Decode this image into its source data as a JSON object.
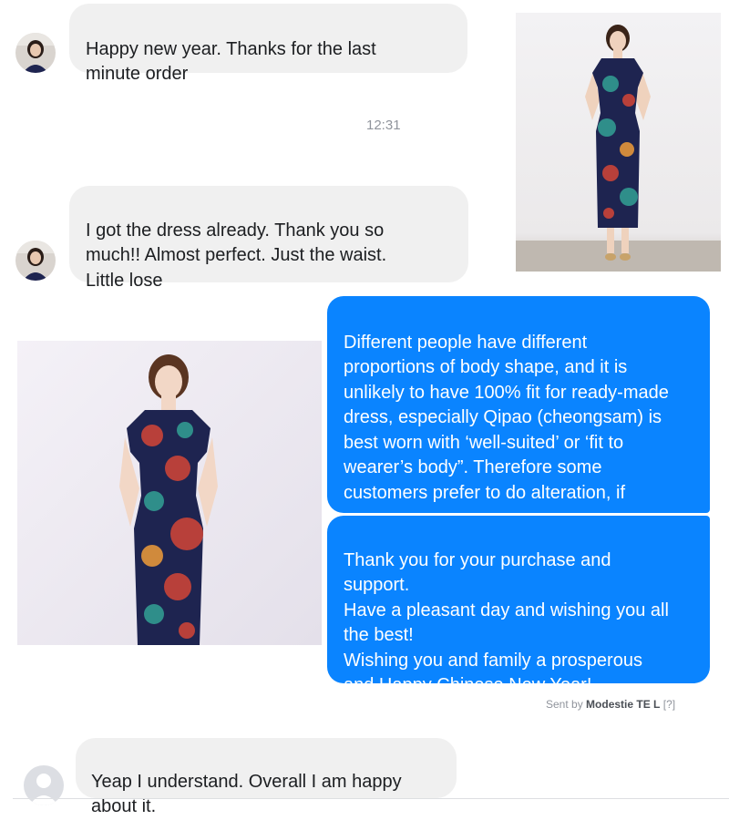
{
  "conversation": {
    "messages": [
      {
        "sender": "customer",
        "text": "Happy new year. Thanks for the last\nminute order"
      },
      {
        "sender": "customer",
        "text": "I got the dress already. Thank you so\nmuch!! Almost perfect. Just the waist.\nLittle lose"
      },
      {
        "sender": "shop",
        "text": "Different people have different\nproportions of body shape, and it is\nunlikely to have 100% fit for ready-made\ndress, especially Qipao (cheongsam) is\nbest worn with ‘well-suited’ or ‘fit to\nwearer’s body”. Therefore some\ncustomers prefer to do alteration, if\nnecessary."
      },
      {
        "sender": "shop",
        "text": "Thank you for your purchase and\nsupport.\nHave a pleasant day and wishing you all\nthe best!\nWishing you and family a prosperous\nand Happy Chinese New Year!"
      },
      {
        "sender": "customer",
        "text": "Yeap I understand. Overall I am happy\nabout it."
      }
    ],
    "timestamp": "12:31",
    "sent_by": {
      "prefix": "Sent by",
      "name": "Modestie TE L",
      "help": "[?]"
    }
  },
  "colors": {
    "incoming_bubble": "#f0f0f0",
    "outgoing_bubble": "#0a84ff",
    "dress_navy": "#1e2450",
    "floral_teal": "#2f8e8a",
    "floral_red": "#b8403a"
  },
  "icons": {
    "customer_avatar": "woman-photo-avatar",
    "anonymous_avatar": "default-person-icon"
  }
}
